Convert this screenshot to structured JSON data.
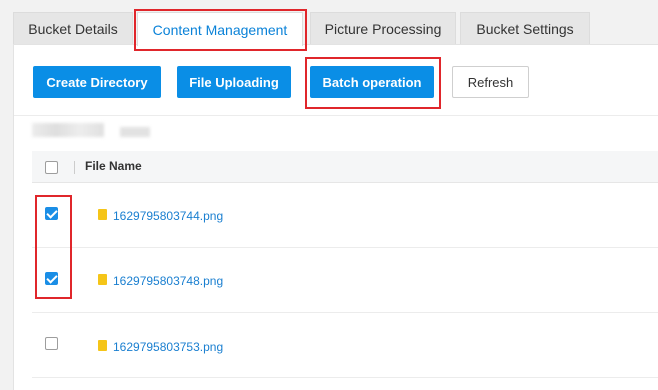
{
  "tabs": [
    {
      "label": "Bucket Details",
      "active": false
    },
    {
      "label": "Content Management",
      "active": true
    },
    {
      "label": "Picture Processing",
      "active": false
    },
    {
      "label": "Bucket Settings",
      "active": false
    }
  ],
  "toolbar": {
    "create_directory": "Create Directory",
    "file_uploading": "File Uploading",
    "batch_operation": "Batch operation",
    "refresh": "Refresh"
  },
  "table": {
    "header_name": "File Name",
    "rows": [
      {
        "name": "1629795803744.png",
        "checked": true
      },
      {
        "name": "1629795803748.png",
        "checked": true
      },
      {
        "name": "1629795803753.png",
        "checked": false
      }
    ]
  },
  "colors": {
    "accent": "#0a8ee6",
    "link": "#1a7fd0",
    "highlight": "#e0262b",
    "file_icon": "#f5c518"
  }
}
